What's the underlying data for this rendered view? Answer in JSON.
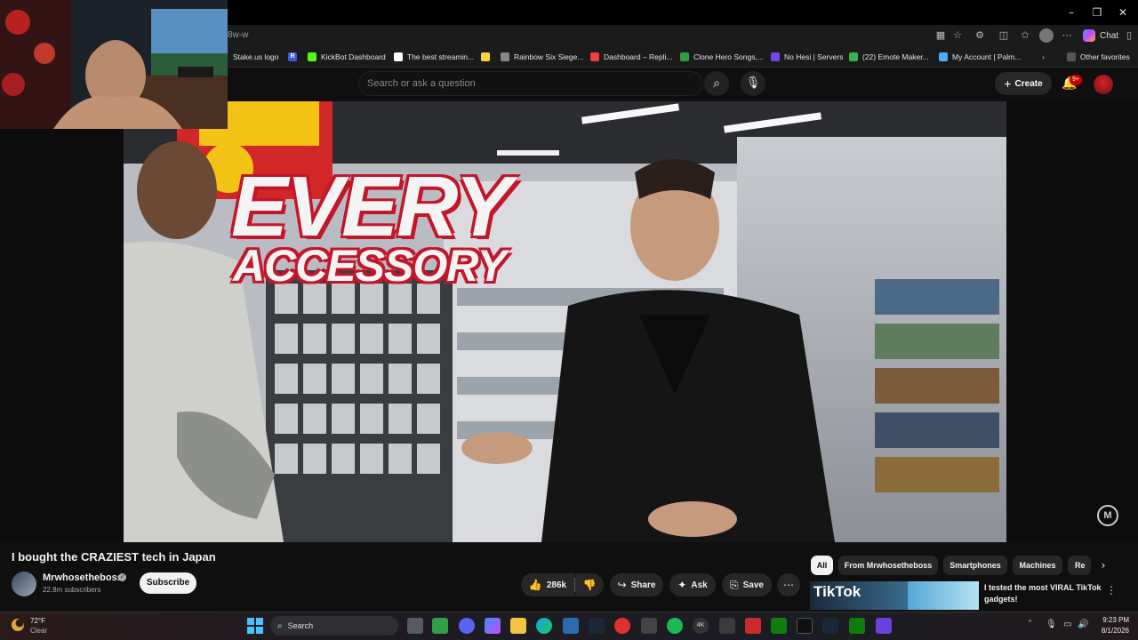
{
  "browser": {
    "url_fragment": "8w-w",
    "chat_label": "Chat",
    "other_favorites": "Other favorites",
    "bookmarks": [
      {
        "label": "Stake.us logo",
        "color": "#1b1b1b"
      },
      {
        "label": "",
        "color": "#3b5bdb",
        "letter": "R"
      },
      {
        "label": "KickBot Dashboard",
        "color": "#53fc18"
      },
      {
        "label": "The best streamin...",
        "color": "#ffffff"
      },
      {
        "label": "",
        "color": "#ffd43b"
      },
      {
        "label": "Rainbow Six Siege...",
        "color": "#888888"
      },
      {
        "label": "Dashboard – Repli...",
        "color": "#f03e3e"
      },
      {
        "label": "Clone Hero Songs,...",
        "color": "#2f9e44"
      },
      {
        "label": "No Hesi | Servers",
        "color": "#7048e8"
      },
      {
        "label": "(22) Emote Maker...",
        "color": "#37b24d"
      },
      {
        "label": "My Account | Palm...",
        "color": "#4dabf7"
      }
    ]
  },
  "youtube": {
    "search_placeholder": "Search or ask a question",
    "create_label": "Create",
    "notification_count": "9+",
    "video": {
      "overlay_line1": "EVERY",
      "overlay_line2": "ACCESSORY",
      "title": "I bought the CRAZIEST tech in Japan"
    },
    "channel": {
      "name": "Mrwhosetheboss",
      "subscribers": "22.8m subscribers",
      "subscribe_label": "Subscribe"
    },
    "actions": {
      "likes": "286k",
      "share": "Share",
      "ask": "Ask",
      "save": "Save"
    },
    "chips": [
      "All",
      "From Mrwhosetheboss",
      "Smartphones",
      "Machines",
      "Re"
    ],
    "recommendation": {
      "thumb_text": "TikTok",
      "title": "I tested the most VIRAL TikTok gadgets!"
    }
  },
  "taskbar": {
    "temperature": "72°F",
    "condition": "Clear",
    "search_label": "Search",
    "time": "9:23 PM",
    "date": "8/1/2026",
    "tray_extra": "4K"
  }
}
